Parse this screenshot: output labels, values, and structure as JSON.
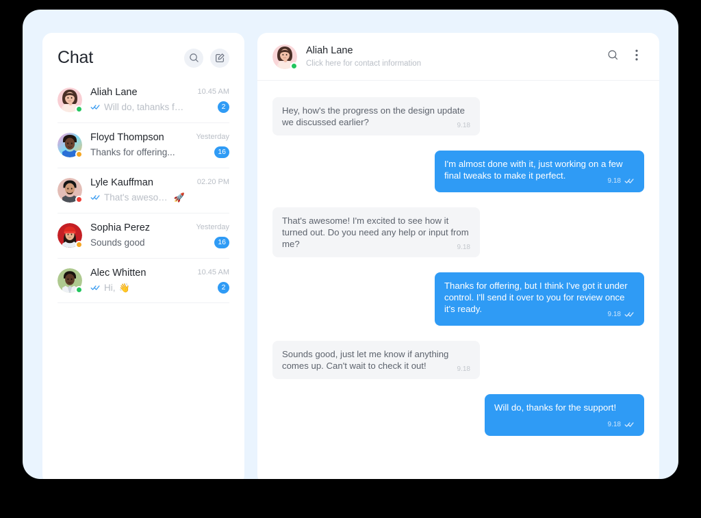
{
  "theme": {
    "backdrop": "#000000",
    "card_background": "#eaf4fe",
    "panel_background": "#ffffff",
    "accent_blue": "#2f9bf5",
    "bubble_in_background": "#f4f5f7",
    "text_primary": "#1f2329",
    "text_muted": "#b9bec6"
  },
  "sidebar": {
    "title": "Chat",
    "actions": [
      {
        "name": "search-icon",
        "label": "Search"
      },
      {
        "name": "compose-icon",
        "label": "New message"
      }
    ],
    "chats": [
      {
        "name": "Aliah Lane",
        "preview": "Will do, tahanks for...",
        "time": "10.45 AM",
        "badge": "2",
        "has_ticks": true,
        "preview_muted": true,
        "presence": "online",
        "presence_color": "#22c55e",
        "emoji": ""
      },
      {
        "name": "Floyd Thompson",
        "preview": "Thanks for offering...",
        "time": "Yesterday",
        "badge": "16",
        "has_ticks": false,
        "preview_muted": false,
        "presence": "away",
        "presence_color": "#f5a623",
        "emoji": ""
      },
      {
        "name": "Lyle Kauffman",
        "preview": "That's awesome",
        "time": "02.20 PM",
        "badge": "",
        "has_ticks": true,
        "preview_muted": true,
        "presence": "busy",
        "presence_color": "#ef3e36",
        "emoji": "🚀"
      },
      {
        "name": "Sophia Perez",
        "preview": "Sounds good",
        "time": "Yesterday",
        "badge": "16",
        "has_ticks": false,
        "preview_muted": false,
        "presence": "away",
        "presence_color": "#f5a623",
        "emoji": ""
      },
      {
        "name": "Alec Whitten",
        "preview": "Hi,",
        "time": "10.45 AM",
        "badge": "2",
        "has_ticks": true,
        "preview_muted": true,
        "presence": "online",
        "presence_color": "#22c55e",
        "emoji": "👋"
      }
    ]
  },
  "conversation": {
    "peer_name": "Aliah Lane",
    "peer_subtitle": "Click here for contact information",
    "presence_color": "#22c55e",
    "actions": [
      {
        "name": "search-icon",
        "label": "Search in conversation"
      },
      {
        "name": "more-vertical-icon",
        "label": "More options"
      }
    ],
    "messages": [
      {
        "direction": "in",
        "text": "Hey, how's the progress on the design update we discussed earlier?",
        "time": "9.18",
        "ticks": false
      },
      {
        "direction": "out",
        "text": "I'm almost done with it, just working on a few final tweaks to make it perfect.",
        "time": "9.18",
        "ticks": true
      },
      {
        "direction": "in",
        "text": "That's awesome! I'm excited to see how it turned out. Do you need any help or input from me?",
        "time": "9.18",
        "ticks": false
      },
      {
        "direction": "out",
        "text": "Thanks for offering, but I think I've got it under control. I'll send it over to you for review once it's ready.",
        "time": "9.18",
        "ticks": true
      },
      {
        "direction": "in",
        "text": "Sounds good, just let me know if anything comes up. Can't wait to check it out!",
        "time": "9.18",
        "ticks": false
      },
      {
        "direction": "out",
        "text": "Will do, thanks for the support!",
        "time": "9.18",
        "ticks": true
      }
    ]
  }
}
